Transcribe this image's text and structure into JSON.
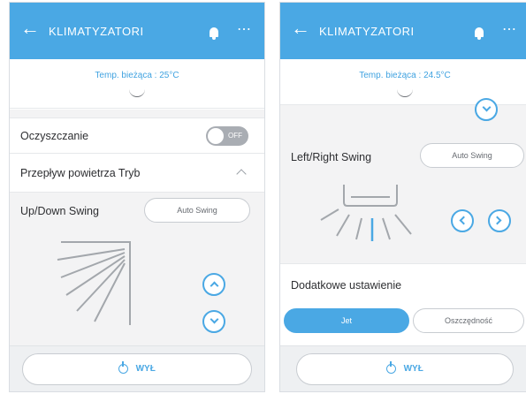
{
  "left": {
    "appbar": {
      "title": "KLIMATYZATORI"
    },
    "temp_text": "Temp. bieżąca : 25°C",
    "purify": {
      "label": "Oczyszczanie",
      "toggle_label": "OFF",
      "toggle_state": "off"
    },
    "airflow": {
      "label": "Przepływ powietrza Tryb"
    },
    "updown": {
      "label": "Up/Down Swing",
      "mode_label": "Auto Swing"
    },
    "power_label": "WYŁ"
  },
  "right": {
    "appbar": {
      "title": "KLIMATYZATORI"
    },
    "temp_text": "Temp. bieżąca : 24.5°C",
    "leftright": {
      "label": "Left/Right Swing",
      "mode_label": "Auto Swing"
    },
    "extra": {
      "label": "Dodatkowe ustawienie",
      "options": [
        "Jet",
        "Oszczędność"
      ],
      "selected": "Jet"
    },
    "power_label": "WYŁ"
  },
  "colors": {
    "accent": "#4aa8e4",
    "toggle_off": "#a9adb3",
    "text": "#2e2f32"
  },
  "icons": [
    "back-arrow-icon",
    "bell-icon",
    "more-icon",
    "power-icon",
    "vane-up-down-icon",
    "vane-left-right-icon"
  ]
}
